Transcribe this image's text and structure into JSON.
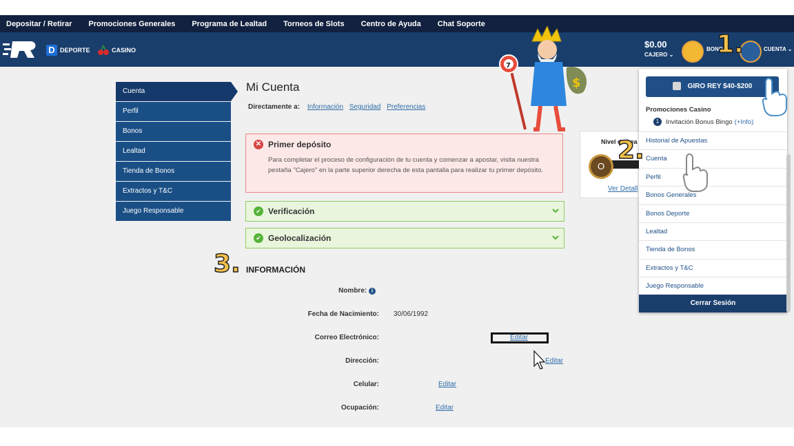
{
  "topnav": [
    "Depositar / Retirar",
    "Promociones Generales",
    "Programa de Lealtad",
    "Torneos de Slots",
    "Centro de Ayuda",
    "Chat Soporte"
  ],
  "header": {
    "deporte": "DEPORTE",
    "casino": "CASINO",
    "balance": "$0.00",
    "cajero": "CAJERO",
    "bonos": "BONOS",
    "cuenta": "CUENTA"
  },
  "sidemenu": [
    "Cuenta",
    "Perfil",
    "Bonos",
    "Lealtad",
    "Tienda de Bonos",
    "Extractos y T&C",
    "Juego Responsable"
  ],
  "main": {
    "title": "Mi Cuenta",
    "direct_label": "Directamente a:",
    "direct_links": [
      "Información",
      "Seguridad",
      "Preferencias"
    ],
    "alert_title": "Primer depósito",
    "alert_body": "Para completar el proceso de configuración de tu cuenta y comenzar a apostar, visita nuestra pestaña \"Cajero\" en la parte superior derecha de esta pantalla para realizar tu primer depósito.",
    "verificacion": "Verificación",
    "geolocalizacion": "Geolocalización",
    "info_title": "INFORMACIÓN"
  },
  "info": {
    "nombre": "Nombre:",
    "fecha": "Fecha de Nacimiento:",
    "fecha_val": "30/06/1992",
    "correo": "Correo Electrónico:",
    "direccion": "Dirección:",
    "celular": "Celular:",
    "ocupacion": "Ocupación:",
    "editar": "Editar"
  },
  "loyalty": {
    "title": "Nivel de Lea",
    "level": "O",
    "link": "Ver Detall"
  },
  "dropdown": {
    "promo": "GIRO REY $40-$200",
    "promo_casino": "Promociones Casino",
    "bingo_num": "1",
    "bingo": "Invitación Bonus Bingo",
    "bingo_info": "(+Info)",
    "items": [
      "Historial de Apuestas",
      "Cuenta",
      "Perfil",
      "Bonos Generales",
      "Bonos Deporte",
      "Lealtad",
      "Tienda de Bonos",
      "Extractos y T&C",
      "Juego Responsable"
    ],
    "logout": "Cerrar Sesión"
  },
  "steps": [
    "1.",
    "2.",
    "3."
  ],
  "colors": {
    "navy": "#12213f",
    "header": "#1a3e6c",
    "menu": "#1a4f86",
    "accent": "#f5c14a"
  }
}
